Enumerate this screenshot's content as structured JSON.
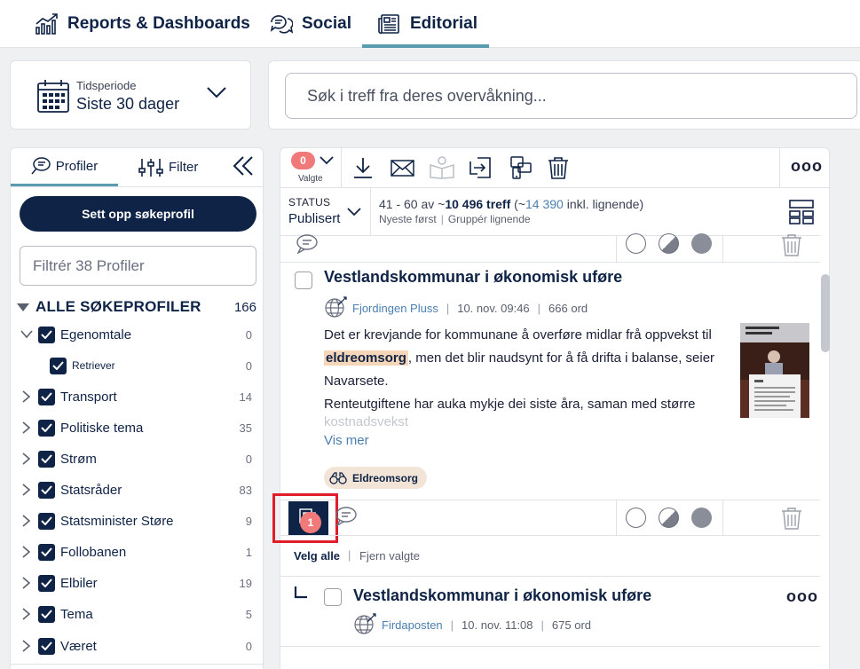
{
  "nav": {
    "tabs": [
      {
        "label": "Reports & Dashboards",
        "icon": "bar-chart-icon"
      },
      {
        "label": "Social",
        "icon": "chat-bubbles-icon"
      },
      {
        "label": "Editorial",
        "icon": "newspaper-icon",
        "active": true
      }
    ]
  },
  "period": {
    "label": "Tidsperiode",
    "value": "Siste 30 dager"
  },
  "search": {
    "placeholder": "Søk i treff fra deres overvåkning..."
  },
  "sidebar": {
    "tabs": {
      "profiler": "Profiler",
      "filter": "Filter"
    },
    "setup_button": "Sett opp søkeprofil",
    "filter_placeholder": "Filtrér 38 Profiler",
    "all_profiles": {
      "label": "ALLE SØKEPROFILER",
      "count": "166"
    },
    "profiles": [
      {
        "label": "Egenomtale",
        "count": "0",
        "expanded": true
      },
      {
        "label": "Retriever",
        "count": "0",
        "child": true
      },
      {
        "label": "Transport",
        "count": "14"
      },
      {
        "label": "Politiske tema",
        "count": "35"
      },
      {
        "label": "Strøm",
        "count": "0"
      },
      {
        "label": "Statsråder",
        "count": "83"
      },
      {
        "label": "Statsminister Støre",
        "count": "9"
      },
      {
        "label": "Follobanen",
        "count": "1"
      },
      {
        "label": "Elbiler",
        "count": "19"
      },
      {
        "label": "Tema",
        "count": "5"
      },
      {
        "label": "Været",
        "count": "0"
      }
    ]
  },
  "toolbar": {
    "selected_count": "0",
    "selected_label": "Valgte"
  },
  "status": {
    "label": "STATUS",
    "value": "Publisert"
  },
  "results": {
    "range": "41 - 60 av ~",
    "total": "10 496 treff",
    "similar_prefix": " (~",
    "similar_count": "14 390",
    "similar_suffix": " inkl. lignende)",
    "sort": "Nyeste først",
    "group": "Gruppér lignende"
  },
  "articles": [
    {
      "title": "Vestlandskommunar i økonomisk uføre",
      "source": "Fjordingen Pluss",
      "date": "10. nov. 09:46",
      "words": "666 ord",
      "body_1": "Det er krevjande for kommunane å overføre midlar frå oppvekst til ",
      "highlight": "eldreomsorg",
      "body_2": ", men det blir naudsynt for å få drifta i balanse, seier Navarsete.",
      "body_3": "Renteutgiftene har auka mykje dei siste åra, saman med større",
      "body_fade": "kostnadsvekst",
      "more": "Vis mer",
      "tag": "Eldreomsorg",
      "duplicates": "1"
    },
    {
      "title": "Vestlandskommunar i økonomisk uføre",
      "source": "Firdaposten",
      "date": "10. nov. 11:08",
      "words": "675 ord"
    }
  ],
  "selection": {
    "select_all": "Velg alle",
    "clear": "Fjern valgte"
  },
  "colors": {
    "navy": "#0f2346",
    "accent": "#5b9bb0",
    "badge": "#f07a7a",
    "highlight": "#f6d6b8"
  }
}
